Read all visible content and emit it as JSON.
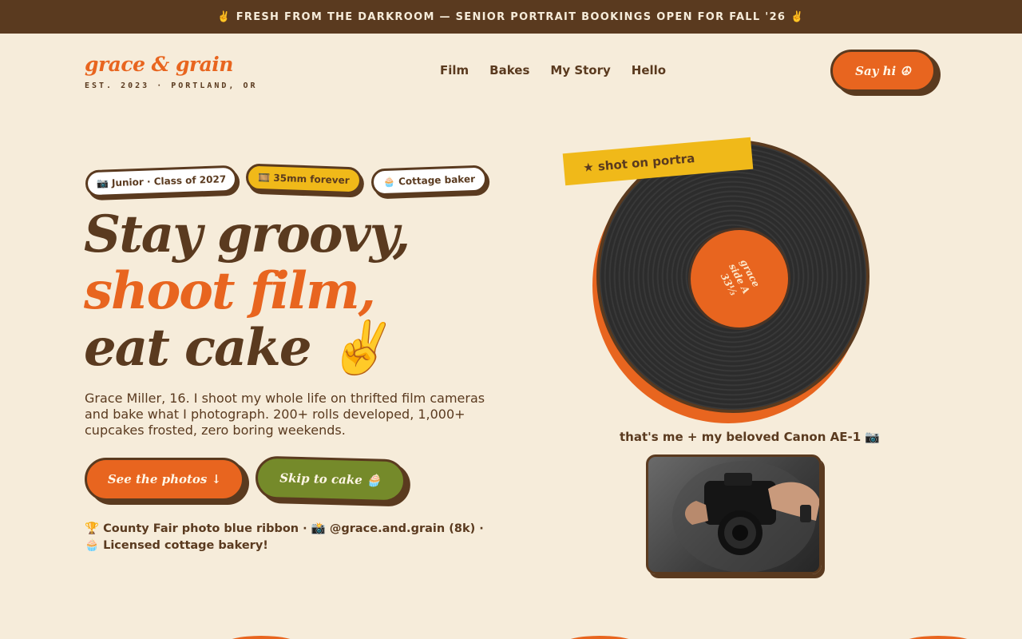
{
  "announcement": "✌️ FRESH FROM THE DARKROOM — SENIOR PORTRAIT BOOKINGS OPEN FOR FALL '26 ✌️",
  "brand": {
    "logo": "grace & grain",
    "tagline": "EST. 2023 · PORTLAND, OR"
  },
  "nav": {
    "items": [
      "Film",
      "Bakes",
      "My Story",
      "Hello"
    ],
    "cta": "Say hi ☮"
  },
  "hero": {
    "chips": [
      "📷 Junior · Class of 2027",
      "🎞️ 35mm forever",
      "🧁 Cottage baker"
    ],
    "headline": {
      "line1": "Stay groovy,",
      "line2": "shoot film,",
      "line3": "eat cake ✌️"
    },
    "intro": "Grace Miller, 16. I shoot my whole life on thrifted film cameras and bake what I photograph. 200+ rolls developed, 1,000+ cupcakes frosted, zero boring weekends.",
    "buttons": {
      "photos": "See the photos ↓",
      "cake": "Skip to cake 🧁"
    },
    "awards": "🏆 County Fair photo blue ribbon · 📸 @grace.and.grain (8k) · 🧁 Licensed cottage bakery!"
  },
  "record": {
    "tape": "★ shot on portra",
    "label_lines": [
      "grace",
      "side A",
      "33⅓"
    ],
    "caption": "that's me + my beloved Canon AE-1 📷"
  },
  "colors": {
    "background": "#f6ecda",
    "brown": "#5a3a1f",
    "orange": "#e8651f",
    "yellow": "#f0b919",
    "olive": "#758a2a"
  }
}
